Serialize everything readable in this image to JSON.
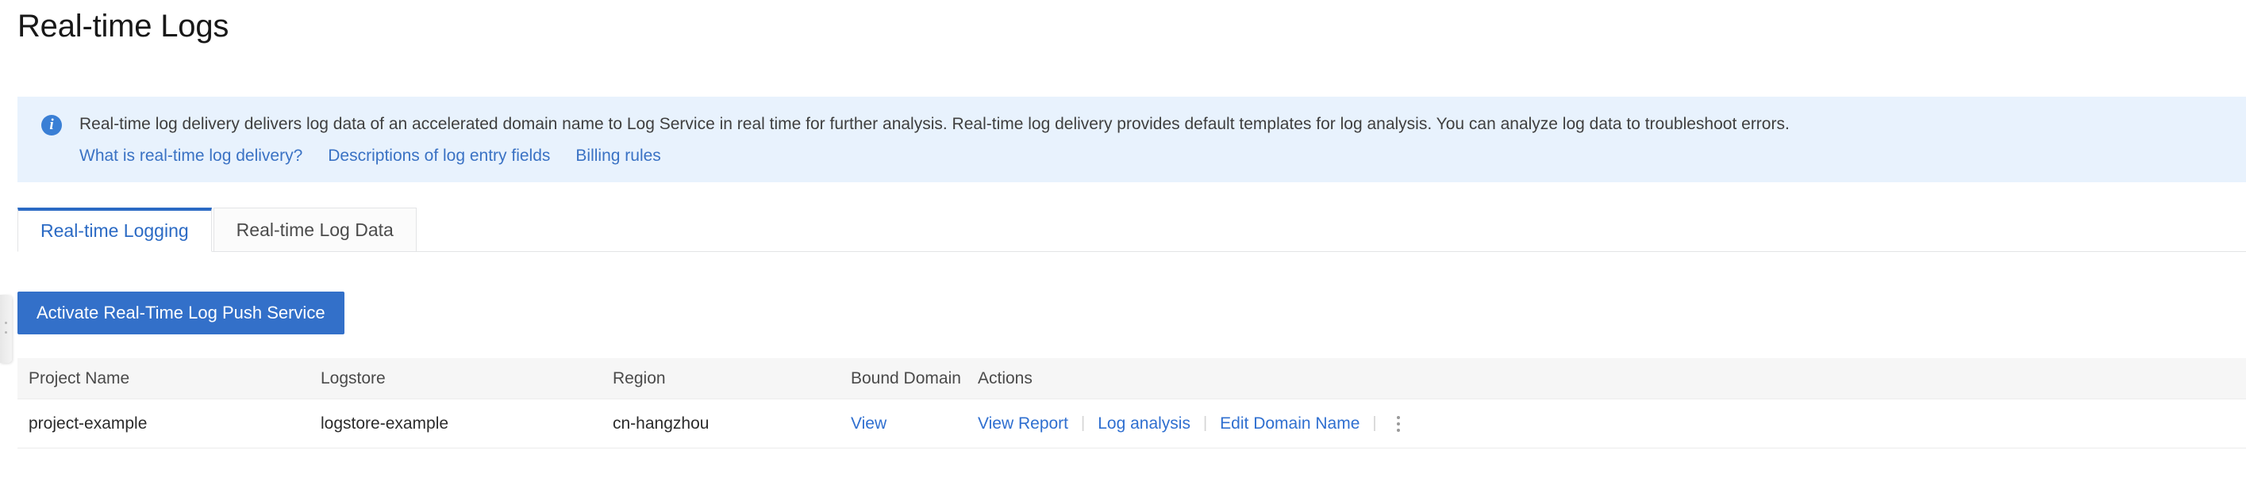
{
  "page": {
    "title": "Real-time Logs"
  },
  "banner": {
    "icon": "info-circle-icon",
    "text": "Real-time log delivery delivers log data of an accelerated domain name to Log Service in real time for further analysis. Real-time log delivery provides default templates for log analysis. You can analyze log data to troubleshoot errors.",
    "links": [
      {
        "label": "What is real-time log delivery?"
      },
      {
        "label": "Descriptions of log entry fields"
      },
      {
        "label": "Billing rules"
      }
    ]
  },
  "tabs": [
    {
      "label": "Real-time Logging",
      "active": true
    },
    {
      "label": "Real-time Log Data",
      "active": false
    }
  ],
  "toolbar": {
    "activate_button_label": "Activate Real-Time Log Push Service"
  },
  "table": {
    "columns": [
      {
        "key": "project",
        "label": "Project Name"
      },
      {
        "key": "logstore",
        "label": "Logstore"
      },
      {
        "key": "region",
        "label": "Region"
      },
      {
        "key": "domain",
        "label": "Bound Domain"
      },
      {
        "key": "actions",
        "label": "Actions"
      }
    ],
    "rows": [
      {
        "project": "project-example",
        "logstore": "logstore-example",
        "region": "cn-hangzhou",
        "domain_link": "View",
        "actions": [
          {
            "label": "View Report"
          },
          {
            "label": "Log analysis"
          },
          {
            "label": "Edit Domain Name"
          }
        ],
        "more_icon": "kebab-menu-icon"
      }
    ]
  },
  "colors": {
    "accent": "#3370c9",
    "link": "#2f6fd0",
    "banner_bg": "#e8f2fd",
    "header_bg": "#f6f6f6"
  }
}
